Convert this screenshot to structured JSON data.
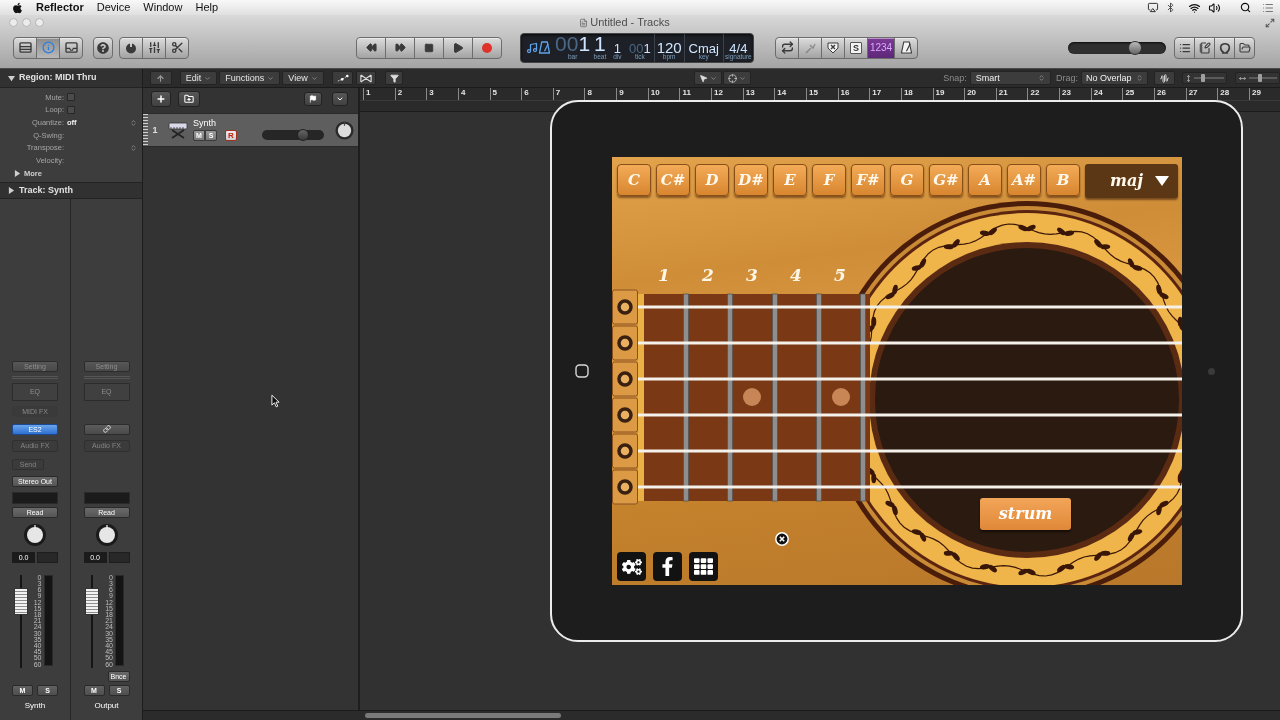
{
  "menu_bar": {
    "app": "Reflector",
    "items": [
      "Device",
      "Window",
      "Help"
    ]
  },
  "window": {
    "title": "Untitled - Tracks"
  },
  "control_bar": {
    "view_buttons": [
      {
        "selected": false
      },
      {
        "selected": true
      },
      {
        "selected": false
      }
    ],
    "lcd": [
      {
        "ghost": "00",
        "value": "1",
        "label": "bar"
      },
      {
        "value": "1",
        "label": "beat"
      },
      {
        "value": "1",
        "label": "div"
      },
      {
        "ghost": "00",
        "value": "1",
        "label": "tick"
      },
      {
        "value": "120",
        "label": "bpm"
      },
      {
        "value": "Cmaj",
        "label": "key"
      },
      {
        "value": "4/4",
        "label": "signature"
      }
    ],
    "tuner": {
      "disabled": true
    },
    "solo": {
      "label": "S"
    },
    "count_in": {
      "label": "1234",
      "on": true
    },
    "master_volume": {
      "level": 0.71
    }
  },
  "inspector": {
    "region": {
      "title": "Region: MIDI Thru",
      "expanded": true,
      "fields": [
        {
          "kind": "checkbox",
          "label": "Mute:",
          "checked": false
        },
        {
          "kind": "checkbox",
          "label": "Loop:",
          "checked": false
        },
        {
          "kind": "popup",
          "label": "Quantize:",
          "value": "off"
        },
        {
          "kind": "text",
          "label": "Q-Swing:"
        },
        {
          "kind": "popup",
          "label": "Transpose:"
        },
        {
          "kind": "text",
          "label": "Velocity:"
        }
      ],
      "more": {
        "label": "More",
        "expanded": false
      }
    },
    "track": {
      "title": "Track: Synth",
      "expanded": false
    }
  },
  "mixer": [
    {
      "setting": "Setting",
      "eq": "EQ",
      "midi_fx": "MIDI FX",
      "instrument": {
        "kind": "plugin",
        "label": "ES2",
        "active": true
      },
      "audio_fx": "Audio FX",
      "send": "Send",
      "output": "Stereo Out",
      "automation": "Read",
      "volume": "0.0",
      "fader": {
        "level": 0.8
      },
      "meter_scale": [
        "0",
        "3",
        "6",
        "9",
        "12",
        "15",
        "18",
        "21",
        "24",
        "30",
        "35",
        "40",
        "45",
        "50",
        "60"
      ],
      "mute": "M",
      "solo": "S",
      "name": "Synth"
    },
    {
      "setting": "Setting",
      "eq": "EQ",
      "instrument": {
        "kind": "link"
      },
      "audio_fx": "Audio FX",
      "automation": "Read",
      "volume": "0.0",
      "fader": {
        "level": 0.8
      },
      "meter_scale": [
        "0",
        "3",
        "6",
        "9",
        "12",
        "15",
        "18",
        "21",
        "24",
        "30",
        "35",
        "40",
        "45",
        "50",
        "60"
      ],
      "bounce": "Bnce",
      "mute": "M",
      "solo": "S",
      "name": "Output"
    }
  ],
  "tracks": {
    "toolbar": {
      "menus": [
        "Edit",
        "Functions",
        "View"
      ],
      "snap_label": "Snap:",
      "snap": "Smart",
      "drag_label": "Drag:",
      "drag": "No Overlap",
      "vertical_zoom": {
        "level": 0.25
      },
      "horizontal_zoom": {
        "level": 0.35
      }
    },
    "list": [
      {
        "number": "1",
        "name": "Synth",
        "mute": "M",
        "solo": "S",
        "record": "R",
        "level": 0.7
      }
    ],
    "ruler": [
      "1",
      "2",
      "3",
      "4",
      "5",
      "6",
      "7",
      "8",
      "9",
      "10",
      "11",
      "12",
      "13",
      "14",
      "15",
      "16",
      "17",
      "18",
      "19",
      "20",
      "21",
      "22",
      "23",
      "24",
      "25",
      "26",
      "27",
      "28",
      "29"
    ]
  },
  "ipad": {
    "chords": [
      {
        "label": "C"
      },
      {
        "label": "C#"
      },
      {
        "label": "D"
      },
      {
        "label": "D#"
      },
      {
        "label": "E"
      },
      {
        "label": "F"
      },
      {
        "label": "F#"
      },
      {
        "label": "G"
      },
      {
        "label": "G#"
      },
      {
        "label": "A"
      },
      {
        "label": "A#"
      },
      {
        "label": "B"
      }
    ],
    "quality": "maj",
    "frets": [
      "1",
      "2",
      "3",
      "4",
      "5"
    ],
    "strum": "strum"
  }
}
